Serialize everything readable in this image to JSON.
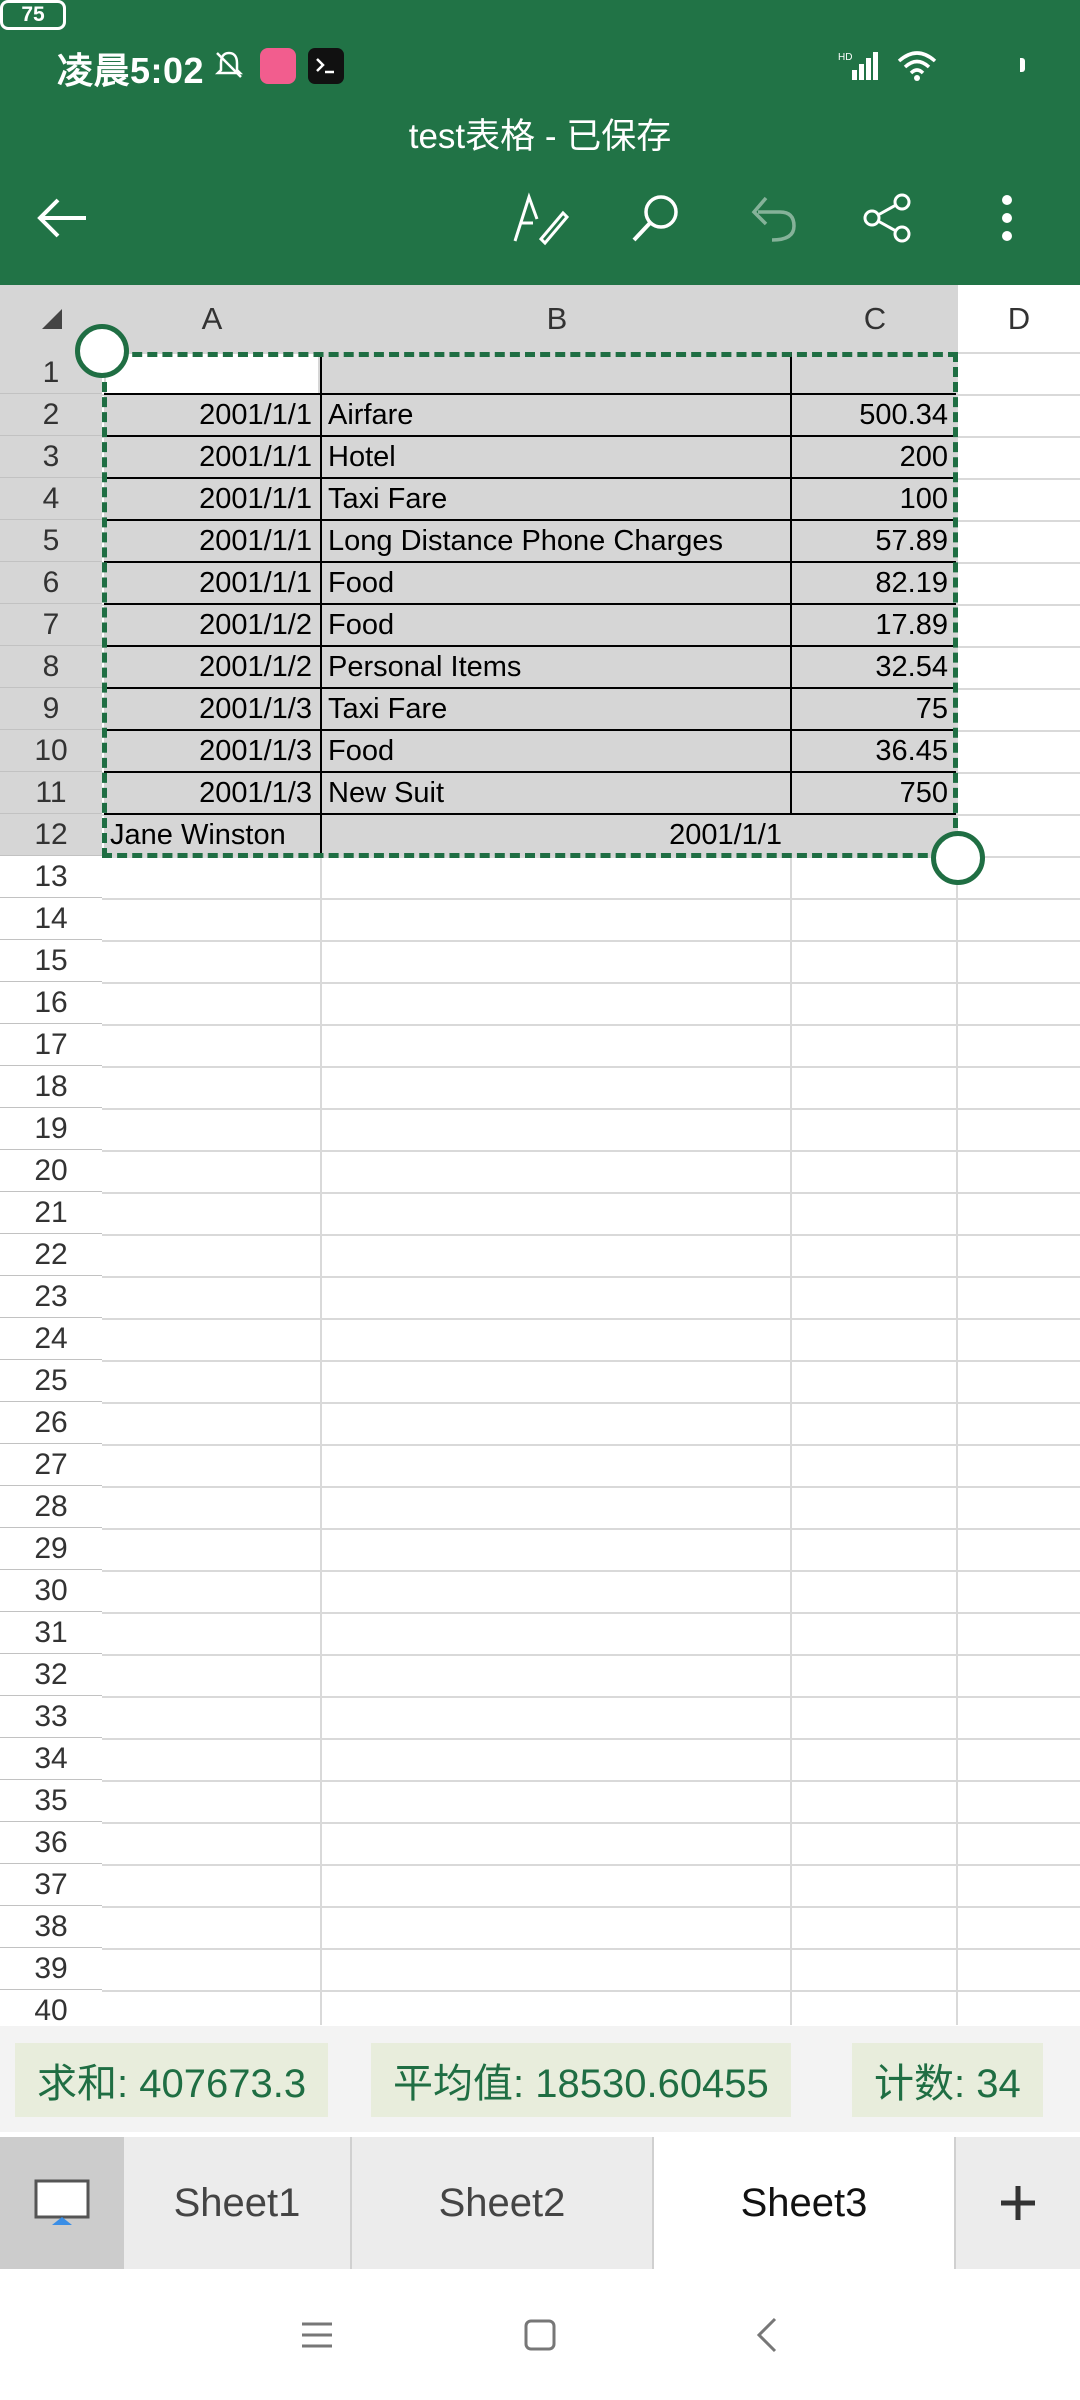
{
  "status_bar": {
    "time": "凌晨5:02",
    "battery": "75"
  },
  "title": "test表格 - 已保存",
  "columns": [
    "A",
    "B",
    "C",
    "D"
  ],
  "rows": [
    "1",
    "2",
    "3",
    "4",
    "5",
    "6",
    "7",
    "8",
    "9",
    "10",
    "11",
    "12",
    "13",
    "14",
    "15",
    "16",
    "17",
    "18",
    "19",
    "20",
    "21",
    "22",
    "23",
    "24",
    "25",
    "26",
    "27",
    "28",
    "29",
    "30",
    "31",
    "32",
    "33",
    "34",
    "35",
    "36",
    "37",
    "38",
    "39",
    "40"
  ],
  "data": [
    {
      "a": "2001/1/1",
      "b": "Airfare",
      "c": "500.34"
    },
    {
      "a": "2001/1/1",
      "b": "Hotel",
      "c": "200"
    },
    {
      "a": "2001/1/1",
      "b": "Taxi Fare",
      "c": "100"
    },
    {
      "a": "2001/1/1",
      "b": "Long Distance Phone Charges",
      "c": "57.89"
    },
    {
      "a": "2001/1/1",
      "b": "Food",
      "c": "82.19"
    },
    {
      "a": "2001/1/2",
      "b": "Food",
      "c": "17.89"
    },
    {
      "a": "2001/1/2",
      "b": "Personal Items",
      "c": "32.54"
    },
    {
      "a": "2001/1/3",
      "b": "Taxi Fare",
      "c": "75"
    },
    {
      "a": "2001/1/3",
      "b": "Food",
      "c": "36.45"
    },
    {
      "a": "2001/1/3",
      "b": "New Suit",
      "c": "750"
    }
  ],
  "row12": {
    "a": "Jane Winston",
    "b": "2001/1/1"
  },
  "summary": {
    "sum": "求和: 407673.3",
    "avg": "平均值: 18530.60455",
    "count": "计数: 34"
  },
  "tabs": [
    "Sheet1",
    "Sheet2",
    "Sheet3"
  ],
  "active_tab": "Sheet3",
  "colors": {
    "accent": "#217346",
    "selection": "#1f6e43",
    "selection_fill": "#d6d6d6",
    "chip_bg": "#e8eddc"
  },
  "icons": [
    "back-arrow-icon",
    "pen-format-icon",
    "search-icon",
    "undo-icon",
    "share-icon",
    "more-icon",
    "sheet-list-icon",
    "add-sheet-icon",
    "nav-menu-icon",
    "nav-home-icon",
    "nav-back-icon"
  ]
}
